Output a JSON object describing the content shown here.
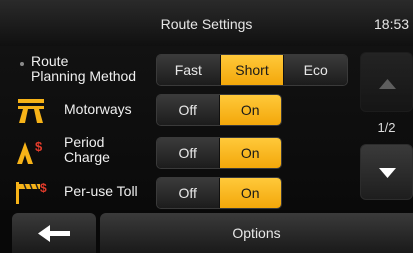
{
  "header": {
    "title": "Route Settings",
    "clock": "18:53"
  },
  "settings": [
    {
      "label": "Route\nPlanning Method",
      "options": [
        "Fast",
        "Short",
        "Eco"
      ],
      "selected": "Short"
    },
    {
      "label": "Motorways",
      "icon": "motorway-icon",
      "options": [
        "Off",
        "On"
      ],
      "selected": "On"
    },
    {
      "label": "Period\nCharge",
      "icon": "period-charge-icon",
      "options": [
        "Off",
        "On"
      ],
      "selected": "On"
    },
    {
      "label": "Per-use Toll",
      "icon": "toll-icon",
      "options": [
        "Off",
        "On"
      ],
      "selected": "On"
    }
  ],
  "pager": {
    "indicator": "1/2"
  },
  "footer": {
    "back_icon": "back-arrow-icon",
    "options_label": "Options"
  },
  "colors": {
    "accent": "#f7b318",
    "background": "#0b0b0b",
    "button": "#2c2c2c"
  }
}
